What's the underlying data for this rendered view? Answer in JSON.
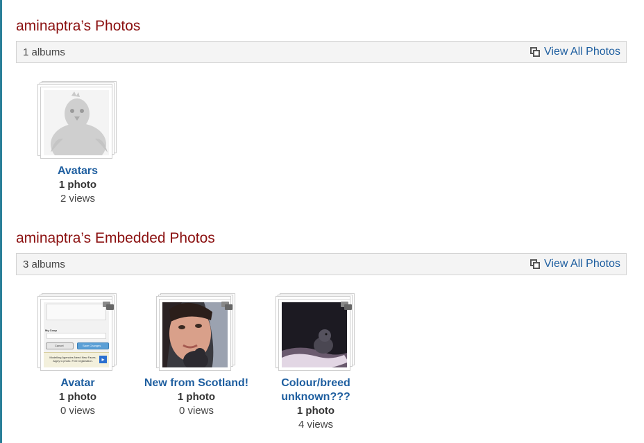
{
  "photos_section": {
    "title": "aminaptra’s Photos",
    "album_count": "1 albums",
    "view_all_label": "View All Photos",
    "albums": [
      {
        "title": "Avatars",
        "count": "1 photo",
        "views": "2 views"
      }
    ]
  },
  "embedded_section": {
    "title": "aminaptra’s Embedded Photos",
    "album_count": "3 albums",
    "view_all_label": "View All Photos",
    "albums": [
      {
        "title": "Avatar",
        "count": "1 photo",
        "views": "0 views",
        "thumb_text": {
          "field": "My Coop",
          "cancel": "Cancel",
          "save": "Save Changes",
          "ad": "Modelling Agencies Need New Faces. Apply w photo. Free registration."
        }
      },
      {
        "title": "New from Scotland!",
        "count": "1 photo",
        "views": "0 views"
      },
      {
        "title_line1": "Colour/breed",
        "title_line2": "unknown???",
        "count": "1 photo",
        "views": "4 views"
      }
    ]
  },
  "colors": {
    "heading": "#8b1010",
    "link": "#1f5fa0",
    "left_rule": "#2a7f99"
  },
  "icons": [
    "album-stack-icon",
    "comment-icon"
  ]
}
